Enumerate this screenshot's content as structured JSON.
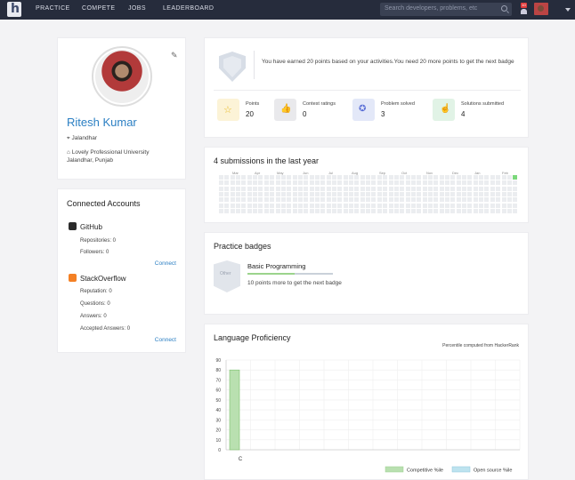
{
  "header": {
    "logo_text": "h",
    "nav": [
      "PRACTICE",
      "COMPETE",
      "JOBS",
      "LEADERBOARD"
    ],
    "search_placeholder": "Search developers, problems, etc",
    "notification_count": "10"
  },
  "profile": {
    "name": "Ritesh Kumar",
    "location": "Jalandhar",
    "institution_line1": "Lovely Professional University",
    "institution_line2": "Jalandhar, Punjab"
  },
  "accounts": {
    "title": "Connected Accounts",
    "github": {
      "name": "GitHub",
      "repos": "Repositories: 0",
      "followers": "Followers: 0",
      "connect": "Connect"
    },
    "stackoverflow": {
      "name": "StackOverflow",
      "reputation": "Reputation: 0",
      "questions": "Questions: 0",
      "answers": "Answers: 0",
      "accepted": "Accepted Answers: 0",
      "connect": "Connect"
    }
  },
  "badge": {
    "message": "You have earned 20 points based on your activities.You need 20 more points to get the next badge",
    "stats": [
      {
        "label": "Points",
        "value": "20",
        "icon": "star-icon",
        "color": "#fcf3d7"
      },
      {
        "label": "Contest ratings",
        "value": "0",
        "icon": "thumbs-up-icon",
        "color": "#e9e9ec"
      },
      {
        "label": "Problem solved",
        "value": "3",
        "icon": "check-badge-icon",
        "color": "#e3e8f8"
      },
      {
        "label": "Solutions submitted",
        "value": "4",
        "icon": "hand-pointer-icon",
        "color": "#e1f3e6"
      }
    ]
  },
  "submissions": {
    "title": "4 submissions in the last year",
    "months": [
      "Mar",
      "Apr",
      "May",
      "Jun",
      "Jul",
      "Aug",
      "Sep",
      "Oct",
      "Nov",
      "Dec",
      "Jan",
      "Feb"
    ]
  },
  "practice": {
    "title": "Practice badges",
    "badge_label": "Other",
    "badge_title": "Basic Programming",
    "progress": 0.55,
    "badge_text": "10 points more to get the next badge"
  },
  "language": {
    "title": "Language Proficiency",
    "note": "Percentile computed from HackerRank",
    "legend_competitive": "Competitive %ile",
    "legend_opensource": "Open source %ile"
  },
  "chart_data": {
    "type": "bar",
    "categories": [
      "C"
    ],
    "series": [
      {
        "name": "Competitive %ile",
        "values": [
          80
        ],
        "color": "#b9e0b0"
      },
      {
        "name": "Open source %ile",
        "values": [
          0
        ],
        "color": "#bde3ef"
      }
    ],
    "yticks": [
      0,
      10,
      20,
      30,
      40,
      50,
      60,
      70,
      80,
      90
    ],
    "ylim": [
      0,
      90
    ],
    "grid": true,
    "legend": "bottom-right"
  }
}
